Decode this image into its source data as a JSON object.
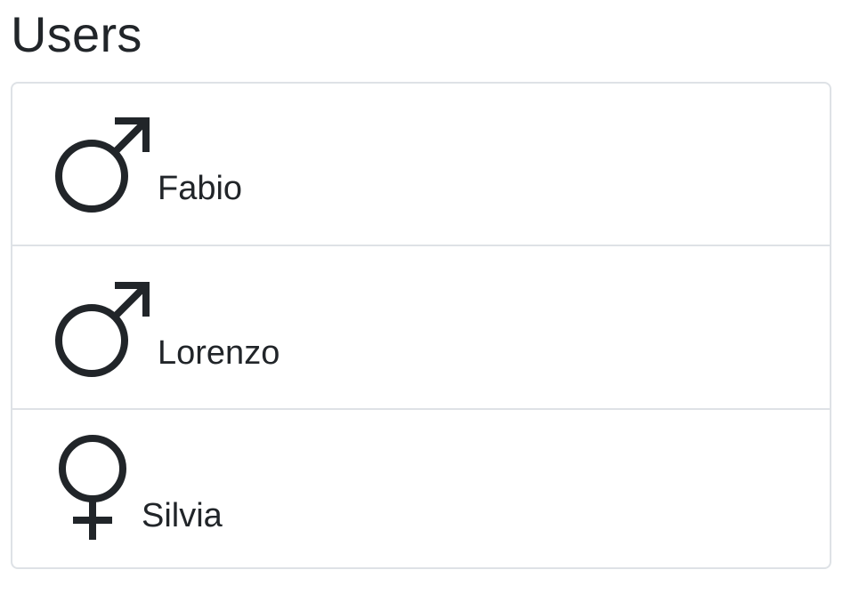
{
  "header": {
    "title": "Users"
  },
  "users": [
    {
      "name": "Fabio",
      "gender_icon": "male-symbol-icon"
    },
    {
      "name": "Lorenzo",
      "gender_icon": "male-symbol-icon"
    },
    {
      "name": "Silvia",
      "gender_icon": "female-symbol-icon"
    }
  ],
  "colors": {
    "text": "#212529",
    "border": "#dee2e6",
    "background": "#ffffff"
  }
}
